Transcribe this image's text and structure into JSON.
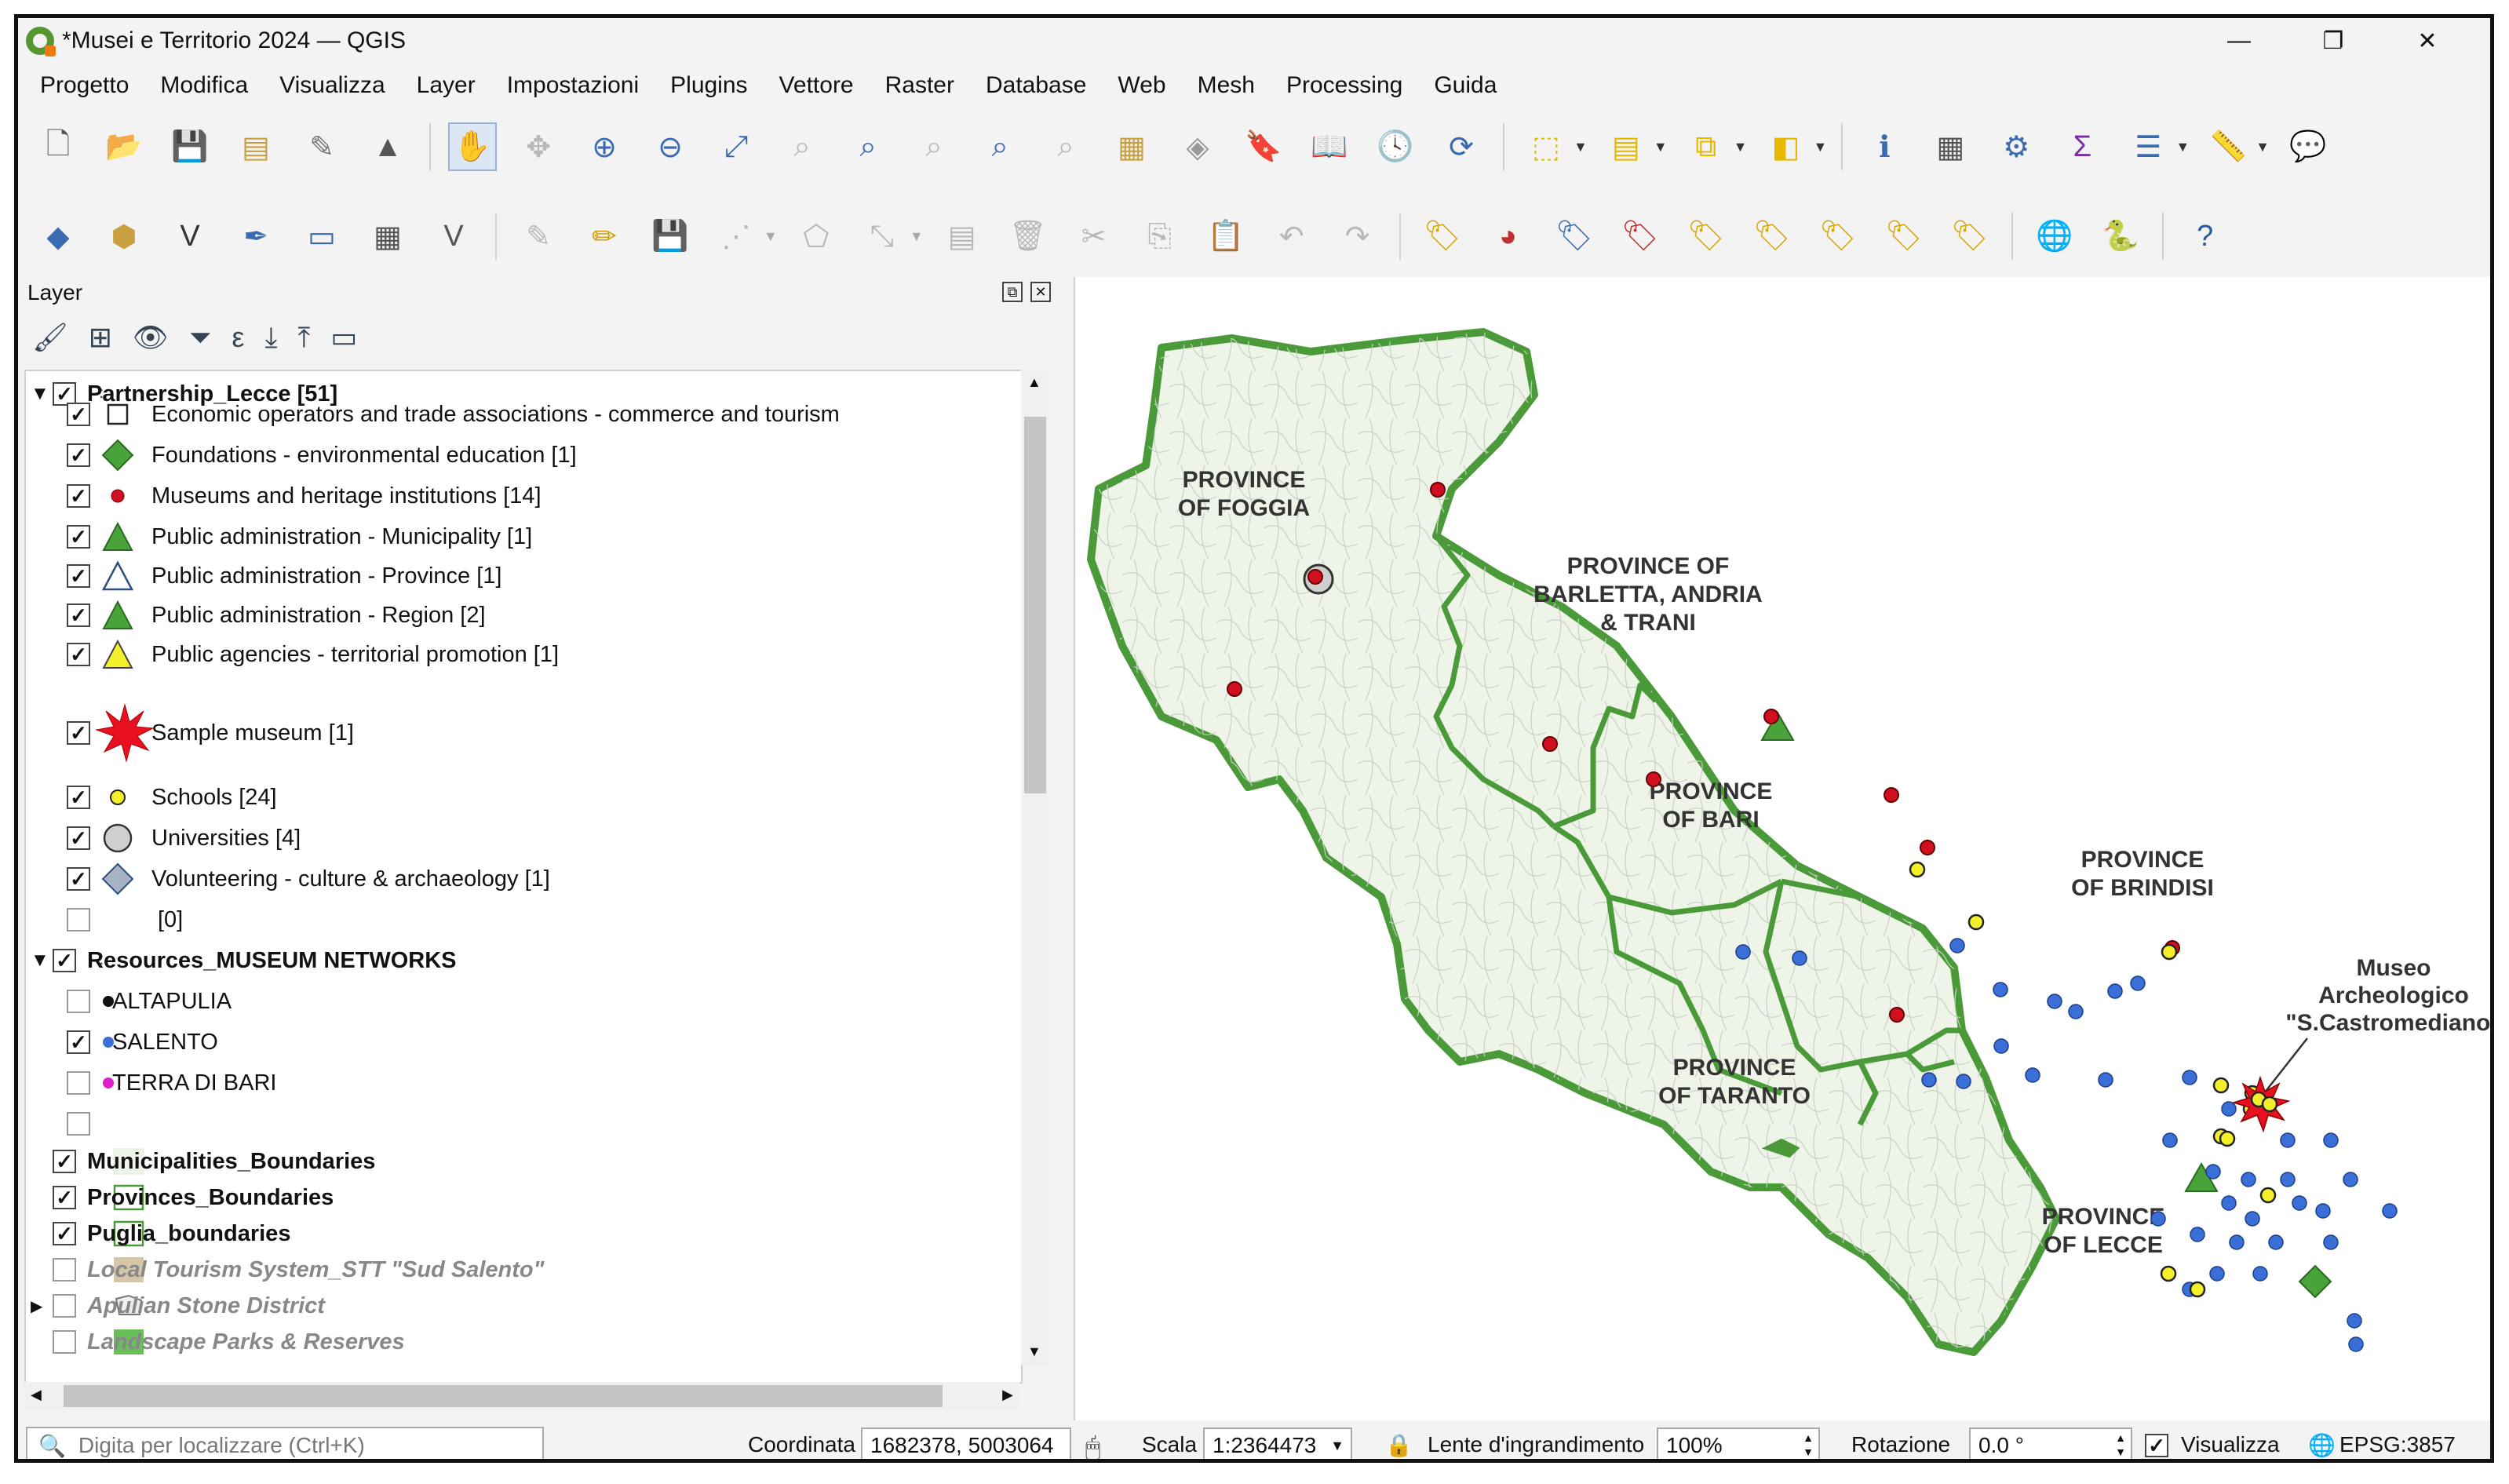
{
  "window": {
    "title": "*Musei e Territorio 2024 — QGIS",
    "min": "—",
    "restore": "❐",
    "close": "✕"
  },
  "menu": [
    "Progetto",
    "Modifica",
    "Visualizza",
    "Layer",
    "Impostazioni",
    "Plugins",
    "Vettore",
    "Raster",
    "Database",
    "Web",
    "Mesh",
    "Processing",
    "Guida"
  ],
  "layers_panel": {
    "title": "Layer",
    "tree": [
      {
        "label": "Partnership_Lecce [51]",
        "checked": true,
        "bold": true,
        "expanded": true
      },
      {
        "label": "Economic operators and trade associations - commerce and tourism",
        "checked": true,
        "symbol": "square-outline"
      },
      {
        "label": "Foundations - environmental education [1]",
        "checked": true,
        "symbol": "diamond-green"
      },
      {
        "label": "Museums and heritage institutions [14]",
        "checked": true,
        "symbol": "dot-red"
      },
      {
        "label": "Public administration - Municipality [1]",
        "checked": true,
        "symbol": "triangle-green"
      },
      {
        "label": "Public administration - Province [1]",
        "checked": true,
        "symbol": "triangle-outline"
      },
      {
        "label": "Public administration - Region [2]",
        "checked": true,
        "symbol": "triangle-green"
      },
      {
        "label": "Public agencies - territorial promotion [1]",
        "checked": true,
        "symbol": "triangle-yellow"
      },
      {
        "label": "Sample museum [1]",
        "checked": true,
        "symbol": "star-red"
      },
      {
        "label": "Schools [24]",
        "checked": true,
        "symbol": "dot-yellow"
      },
      {
        "label": "Universities [4]",
        "checked": true,
        "symbol": "circle-gray"
      },
      {
        "label": "Volunteering - culture & archaeology [1]",
        "checked": true,
        "symbol": "diamond-gray"
      },
      {
        "label": "[0]",
        "checked": false
      },
      {
        "label": "Resources_MUSEUM NETWORKS",
        "checked": true,
        "bold": true,
        "expanded": true
      },
      {
        "label": "ALTAPULIA",
        "checked": false,
        "symbol": "dot-black"
      },
      {
        "label": "SALENTO",
        "checked": true,
        "symbol": "dot-blue"
      },
      {
        "label": "TERRA DI BARI",
        "checked": false,
        "symbol": "dot-magenta"
      },
      {
        "label": "",
        "checked": false
      },
      {
        "label": "Municipalities_Boundaries",
        "checked": true,
        "bold": true,
        "symbol": "fill-pale"
      },
      {
        "label": "Provinces_Boundaries",
        "checked": true,
        "bold": true,
        "symbol": "fill-green-outline"
      },
      {
        "label": "Puglia_boundaries",
        "checked": true,
        "bold": true,
        "symbol": "fill-green-outline"
      },
      {
        "label": "Local Tourism System_STT \"Sud Salento\"",
        "checked": false,
        "italic": true,
        "symbol": "fill-tan"
      },
      {
        "label": "Apulian Stone District",
        "checked": false,
        "italic": true,
        "symbol": "polygon-gray"
      },
      {
        "label": "Landscape Parks & Reserves",
        "checked": false,
        "italic": true,
        "symbol": "fill-green"
      }
    ]
  },
  "map": {
    "labels": {
      "foggia": [
        "PROVINCE",
        "OF FOGGIA"
      ],
      "bat": [
        "PROVINCE OF",
        "BARLETTA, ANDRIA",
        "& TRANI"
      ],
      "bari": [
        "PROVINCE",
        "OF BARI"
      ],
      "brindisi": [
        "PROVINCE",
        "OF BRINDISI"
      ],
      "taranto": [
        "PROVINCE",
        "OF TARANTO"
      ],
      "lecce": [
        "PROVINCE",
        "OF LECCE"
      ],
      "museum": [
        "Museo",
        "Archeologico",
        "\"S.Castromediano\""
      ]
    },
    "colors": {
      "boundary": "#4a9a3a",
      "fill": "#eef5e8",
      "red": "#d01020",
      "blue": "#3a6fd8",
      "yellow": "#f3ef2a"
    }
  },
  "status": {
    "locator_placeholder": "Digita per localizzare (Ctrl+K)",
    "coord_label": "Coordinata",
    "coord_value": "1682378, 5003064",
    "scale_label": "Scala",
    "scale_value": "1:2364473",
    "magnifier_label": "Lente d'ingrandimento",
    "magnifier_value": "100%",
    "rotation_label": "Rotazione",
    "rotation_value": "0.0 °",
    "render_label": "Visualizza",
    "crs": "EPSG:3857"
  }
}
